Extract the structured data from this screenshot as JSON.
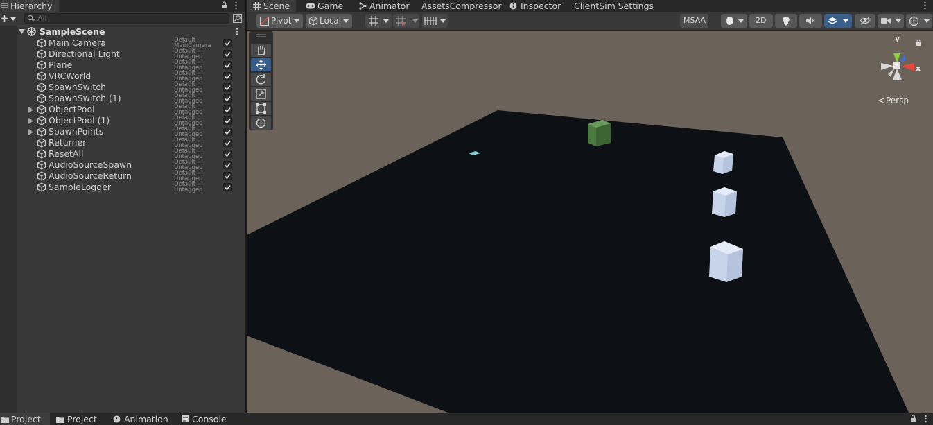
{
  "hierarchy": {
    "tab_label": "Hierarchy",
    "search_placeholder": "All",
    "scene_name": "SampleScene",
    "items": [
      {
        "name": "Main Camera",
        "layer": "Default",
        "tag": "MainCamera",
        "expandable": false
      },
      {
        "name": "Directional Light",
        "layer": "Default",
        "tag": "Untagged",
        "expandable": false
      },
      {
        "name": "Plane",
        "layer": "Default",
        "tag": "Untagged",
        "expandable": false
      },
      {
        "name": "VRCWorld",
        "layer": "Default",
        "tag": "Untagged",
        "expandable": false
      },
      {
        "name": "SpawnSwitch",
        "layer": "Default",
        "tag": "Untagged",
        "expandable": false
      },
      {
        "name": "SpawnSwitch (1)",
        "layer": "Default",
        "tag": "Untagged",
        "expandable": false
      },
      {
        "name": "ObjectPool",
        "layer": "Default",
        "tag": "Untagged",
        "expandable": true
      },
      {
        "name": "ObjectPool (1)",
        "layer": "Default",
        "tag": "Untagged",
        "expandable": true
      },
      {
        "name": "SpawnPoints",
        "layer": "Default",
        "tag": "Untagged",
        "expandable": true
      },
      {
        "name": "Returner",
        "layer": "Default",
        "tag": "Untagged",
        "expandable": false
      },
      {
        "name": "ResetAll",
        "layer": "Default",
        "tag": "Untagged",
        "expandable": false
      },
      {
        "name": "AudioSourceSpawn",
        "layer": "Default",
        "tag": "Untagged",
        "expandable": false
      },
      {
        "name": "AudioSourceReturn",
        "layer": "Default",
        "tag": "Untagged",
        "expandable": false
      },
      {
        "name": "SampleLogger",
        "layer": "Default",
        "tag": "Untagged",
        "expandable": false
      }
    ]
  },
  "scene_tabs": [
    "Scene",
    "Game",
    "Animator",
    "AssetsCompressor",
    "Inspector",
    "ClientSim Settings"
  ],
  "scene_toolbar": {
    "pivot": "Pivot",
    "local": "Local",
    "msaa": "MSAA",
    "mode_2d": "2D"
  },
  "gizmo": {
    "y": "y",
    "x": "x",
    "projection": "Persp"
  },
  "bottom_tabs": [
    "Project",
    "Project",
    "Animation",
    "Console"
  ],
  "colors": {
    "accent_blue": "#3a5f8a",
    "sky": "#6b6259",
    "plane": "#0d1014",
    "green_cube": "#4f7a43",
    "white_cube": "#d2dcef"
  }
}
